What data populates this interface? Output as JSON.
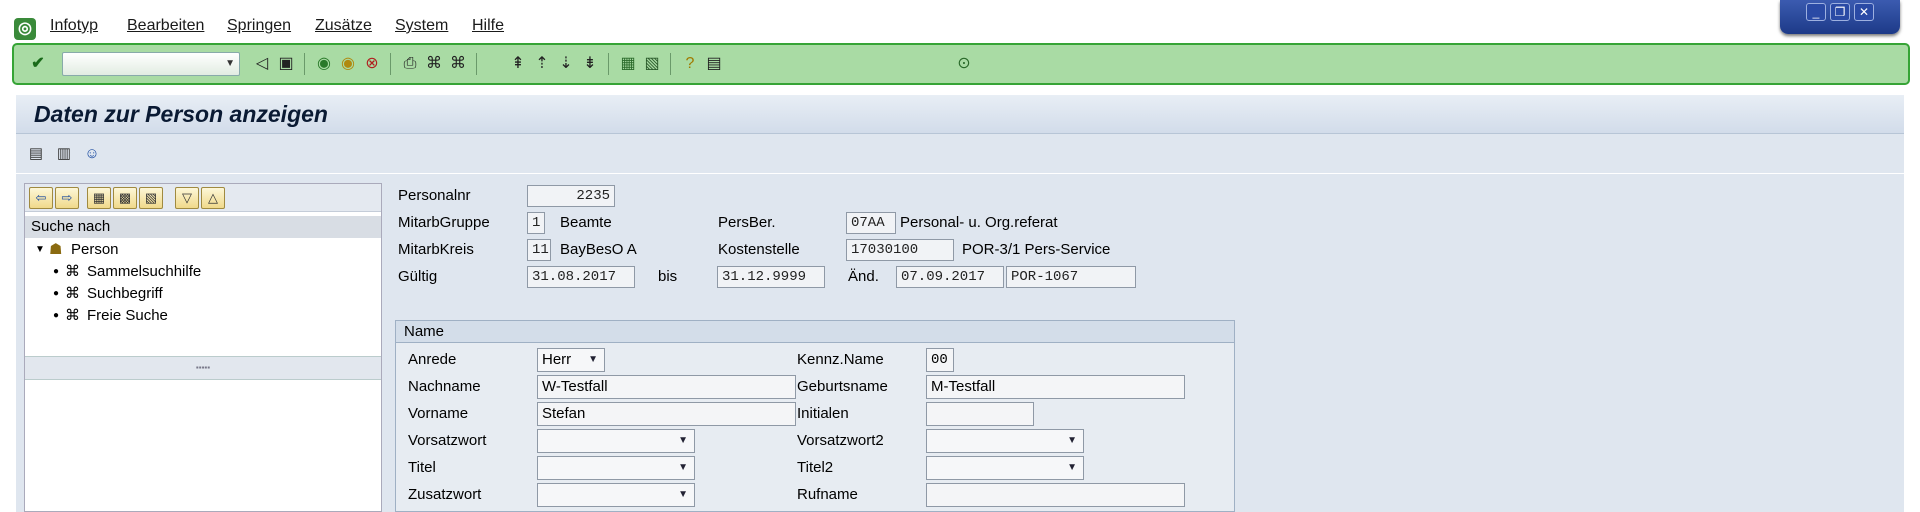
{
  "menu": {
    "items": [
      "Infotyp",
      "Bearbeiten",
      "Springen",
      "Zusätze",
      "System",
      "Hilfe"
    ]
  },
  "window_controls": {
    "minimize": "_",
    "restore": "❐",
    "close": "✕"
  },
  "toolbar": {
    "command_value": ""
  },
  "title": "Daten zur Person anzeigen",
  "navigator": {
    "header": "Suche nach",
    "root": "Person",
    "children": [
      "Sammelsuchhilfe",
      "Suchbegriff",
      "Freie Suche"
    ]
  },
  "header": {
    "personalnr_label": "Personalnr",
    "personalnr_value": "2235",
    "mitarbgruppe_label": "MitarbGruppe",
    "mitarbgruppe_value": "1",
    "mitarbgruppe_text": "Beamte",
    "persber_label": "PersBer.",
    "persber_value": "07AA",
    "persber_text": "Personal- u. Org.referat",
    "mitarbkreis_label": "MitarbKreis",
    "mitarbkreis_value": "11",
    "mitarbkreis_text": "BayBesO A",
    "kostenstelle_label": "Kostenstelle",
    "kostenstelle_value": "17030100",
    "kostenstelle_text": "POR-3/1 Pers-Service",
    "gueltig_label": "Gültig",
    "gueltig_from": "31.08.2017",
    "bis_label": "bis",
    "gueltig_to": "31.12.9999",
    "aend_label": "Änd.",
    "aend_date": "07.09.2017",
    "aend_user": "POR-1067"
  },
  "name_section": {
    "title": "Name",
    "anrede_label": "Anrede",
    "anrede_value": "Herr",
    "kennz_label": "Kennz.Name",
    "kennz_value": "00",
    "nachname_label": "Nachname",
    "nachname_value": "W-Testfall",
    "geburtsname_label": "Geburtsname",
    "geburtsname_value": "M-Testfall",
    "vorname_label": "Vorname",
    "vorname_value": "Stefan",
    "initialen_label": "Initialen",
    "initialen_value": "",
    "vorsatzwort_label": "Vorsatzwort",
    "vorsatzwort_value": "",
    "vorsatzwort2_label": "Vorsatzwort2",
    "vorsatzwort2_value": "",
    "titel_label": "Titel",
    "titel_value": "",
    "titel2_label": "Titel2",
    "titel2_value": "",
    "zusatzwort_label": "Zusatzwort",
    "zusatzwort_value": "",
    "rufname_label": "Rufname",
    "rufname_value": ""
  }
}
